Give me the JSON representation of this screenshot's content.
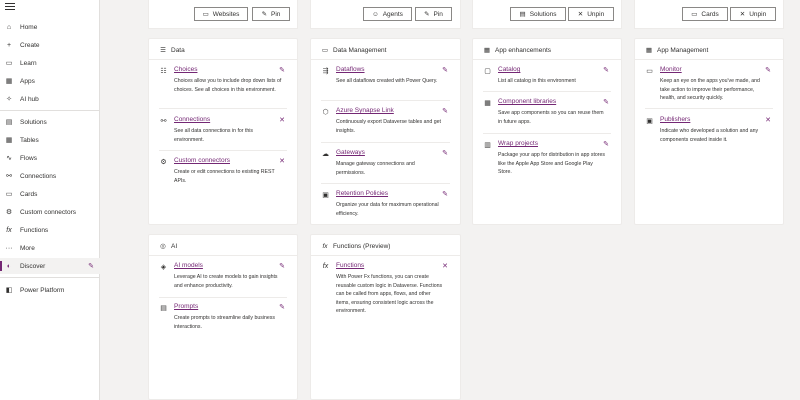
{
  "sidebar": {
    "items": [
      {
        "label": "Home",
        "icon": "home-icon"
      },
      {
        "label": "Create",
        "icon": "plus-icon"
      },
      {
        "label": "Learn",
        "icon": "book-icon"
      },
      {
        "label": "Apps",
        "icon": "apps-icon"
      },
      {
        "label": "AI hub",
        "icon": "ai-hub-icon"
      },
      {
        "label": "Solutions",
        "icon": "solutions-icon"
      },
      {
        "label": "Tables",
        "icon": "table-icon"
      },
      {
        "label": "Flows",
        "icon": "flow-icon"
      },
      {
        "label": "Connections",
        "icon": "connections-icon"
      },
      {
        "label": "Cards",
        "icon": "cards-icon"
      },
      {
        "label": "Custom connectors",
        "icon": "custom-connectors-icon"
      },
      {
        "label": "Functions",
        "icon": "functions-icon"
      },
      {
        "label": "More",
        "icon": "more-icon"
      },
      {
        "label": "Discover",
        "icon": "discover-icon"
      },
      {
        "label": "Power Platform",
        "icon": "power-platform-icon"
      }
    ]
  },
  "top_cards": [
    {
      "primary": "Websites",
      "secondary": "Pin"
    },
    {
      "primary": "Agents",
      "secondary": "Pin"
    },
    {
      "primary": "Solutions",
      "secondary": "Unpin"
    },
    {
      "primary": "Cards",
      "secondary": "Unpin"
    }
  ],
  "cards": {
    "data": {
      "title": "Data",
      "items": [
        {
          "link": "Choices",
          "desc": "Choices allow you to include drop down lists of choices. See all choices in this environment."
        },
        {
          "link": "Connections",
          "desc": "See all data connections in for this environment."
        },
        {
          "link": "Custom connectors",
          "desc": "Create or edit connections to existing REST APIs."
        }
      ]
    },
    "data_management": {
      "title": "Data Management",
      "items": [
        {
          "link": "Dataflows",
          "desc": "See all dataflows created with Power Query."
        },
        {
          "link": "Azure Synapse Link",
          "desc": "Continuously export Dataverse tables and get insights."
        },
        {
          "link": "Gateways",
          "desc": "Manage gateway connections and permissions."
        },
        {
          "link": "Retention Policies",
          "desc": "Organize your data for maximum operational efficiency."
        }
      ]
    },
    "app_enhancements": {
      "title": "App enhancements",
      "items": [
        {
          "link": "Catalog",
          "desc": "List all catalog in this environment"
        },
        {
          "link": "Component libraries",
          "desc": "Save app components so you can reuse them in future apps."
        },
        {
          "link": "Wrap projects",
          "desc": "Package your app for distribution in app stores like the Apple App Store and Google Play Store."
        }
      ]
    },
    "app_management": {
      "title": "App Management",
      "items": [
        {
          "link": "Monitor",
          "desc": "Keep an eye on the apps you've made, and take action to improve their performance, health, and security quickly."
        },
        {
          "link": "Publishers",
          "desc": "Indicate who developed a solution and any components created inside it."
        }
      ]
    },
    "ai": {
      "title": "AI",
      "items": [
        {
          "link": "AI models",
          "desc": "Leverage AI to create models to gain insights and enhance productivity."
        },
        {
          "link": "Prompts",
          "desc": "Create prompts to streamline daily business interactions."
        }
      ]
    },
    "functions": {
      "title": "Functions (Preview)",
      "items": [
        {
          "link": "Functions",
          "desc": "With Power Fx functions, you can create reusable custom logic in Dataverse. Functions can be called from apps, flows, and other items, ensuring consistent logic across the environment."
        }
      ]
    }
  },
  "colors": {
    "accent": "#742774",
    "border": "#edebe9",
    "background": "#f3f2f1"
  }
}
